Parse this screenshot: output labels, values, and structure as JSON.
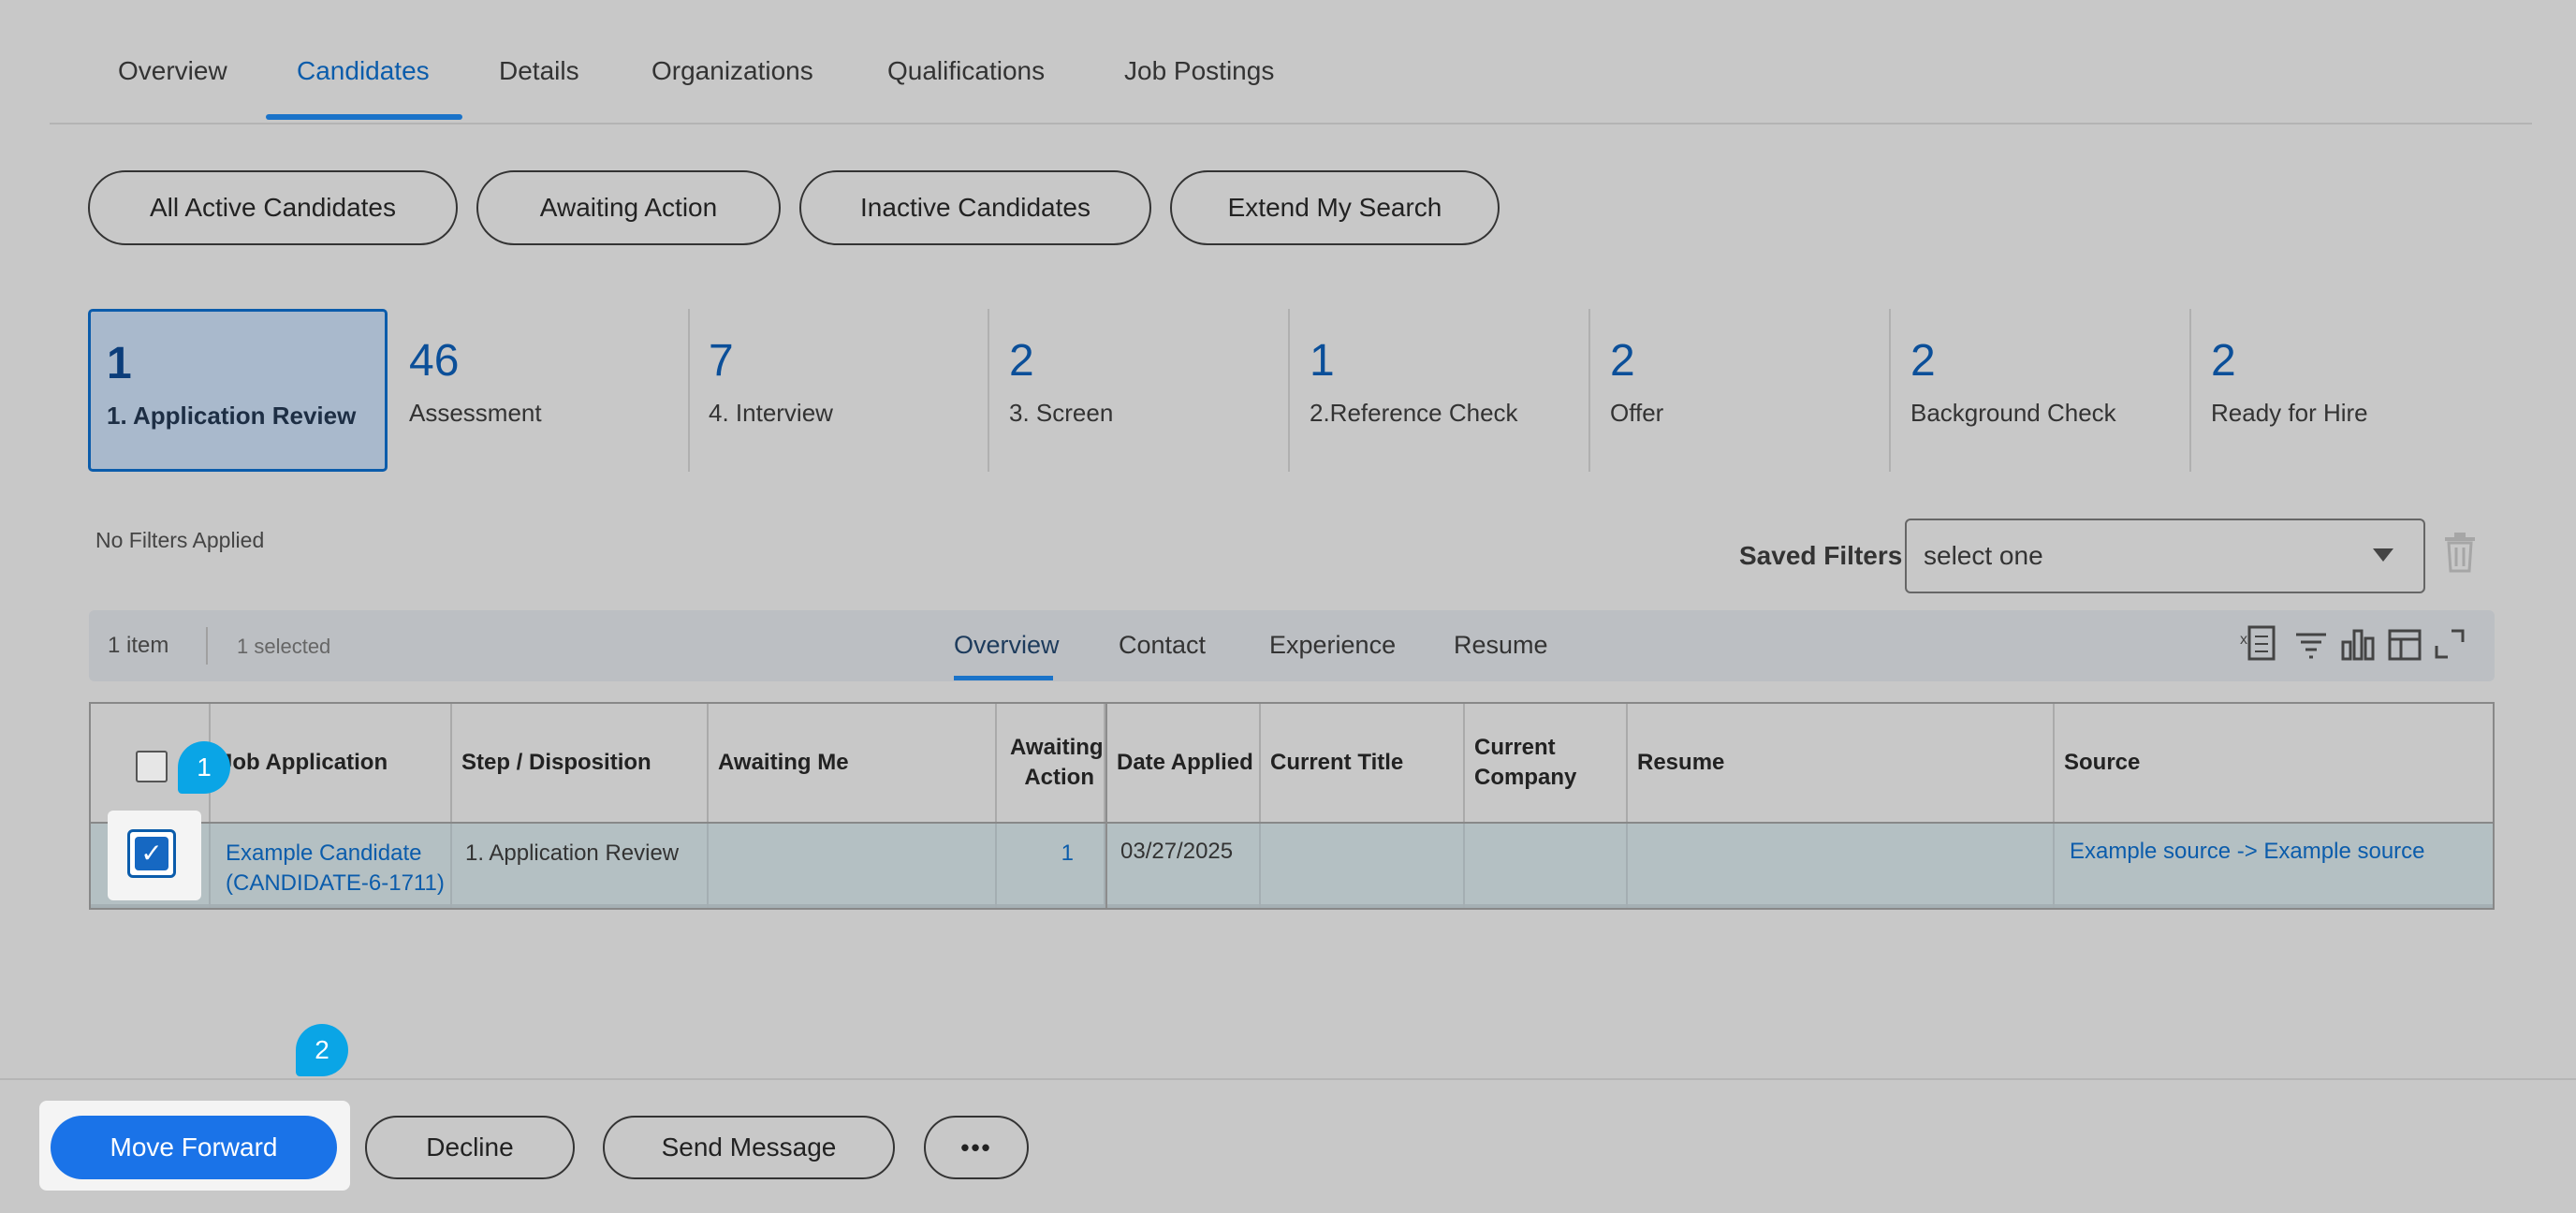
{
  "top_tabs": [
    "Overview",
    "Candidates",
    "Details",
    "Organizations",
    "Qualifications",
    "Job Postings"
  ],
  "top_tab_active": "Candidates",
  "pills": [
    "All Active Candidates",
    "Awaiting Action",
    "Inactive Candidates",
    "Extend My Search"
  ],
  "stages": [
    {
      "count": "1",
      "label": "1. Application Review"
    },
    {
      "count": "46",
      "label": "Assessment"
    },
    {
      "count": "7",
      "label": "4. Interview"
    },
    {
      "count": "2",
      "label": "3. Screen"
    },
    {
      "count": "1",
      "label": "2.Reference Check"
    },
    {
      "count": "2",
      "label": "Offer"
    },
    {
      "count": "2",
      "label": "Background Check"
    },
    {
      "count": "2",
      "label": "Ready for Hire"
    }
  ],
  "filters": {
    "no_filters": "No Filters Applied",
    "saved_label": "Saved Filters",
    "select_value": "select one"
  },
  "toolbar": {
    "count": "1 item",
    "selected": "1 selected",
    "tabs": [
      "Overview",
      "Contact",
      "Experience",
      "Resume"
    ]
  },
  "table": {
    "headers": [
      "Job Application",
      "Step / Disposition",
      "Awaiting Me",
      "Awaiting Action",
      "Date Applied",
      "Current Title",
      "Current Company",
      "Resume",
      "Source"
    ],
    "row": {
      "job_application": "Example Candidate (CANDIDATE-6-1711)",
      "step": "1. Application Review",
      "awaiting_me": "",
      "awaiting_action": "1",
      "date_applied": "03/27/2025",
      "current_title": "",
      "current_company": "",
      "resume": "",
      "source": "Example source -> Example source"
    }
  },
  "markers": [
    "1",
    "2"
  ],
  "actions": {
    "move_forward": "Move Forward",
    "decline": "Decline",
    "send_message": "Send Message",
    "more": "•••"
  },
  "colors": {
    "accent": "#0b5cab",
    "primary_button": "#1a73e8",
    "marker": "#0aa5e6"
  }
}
